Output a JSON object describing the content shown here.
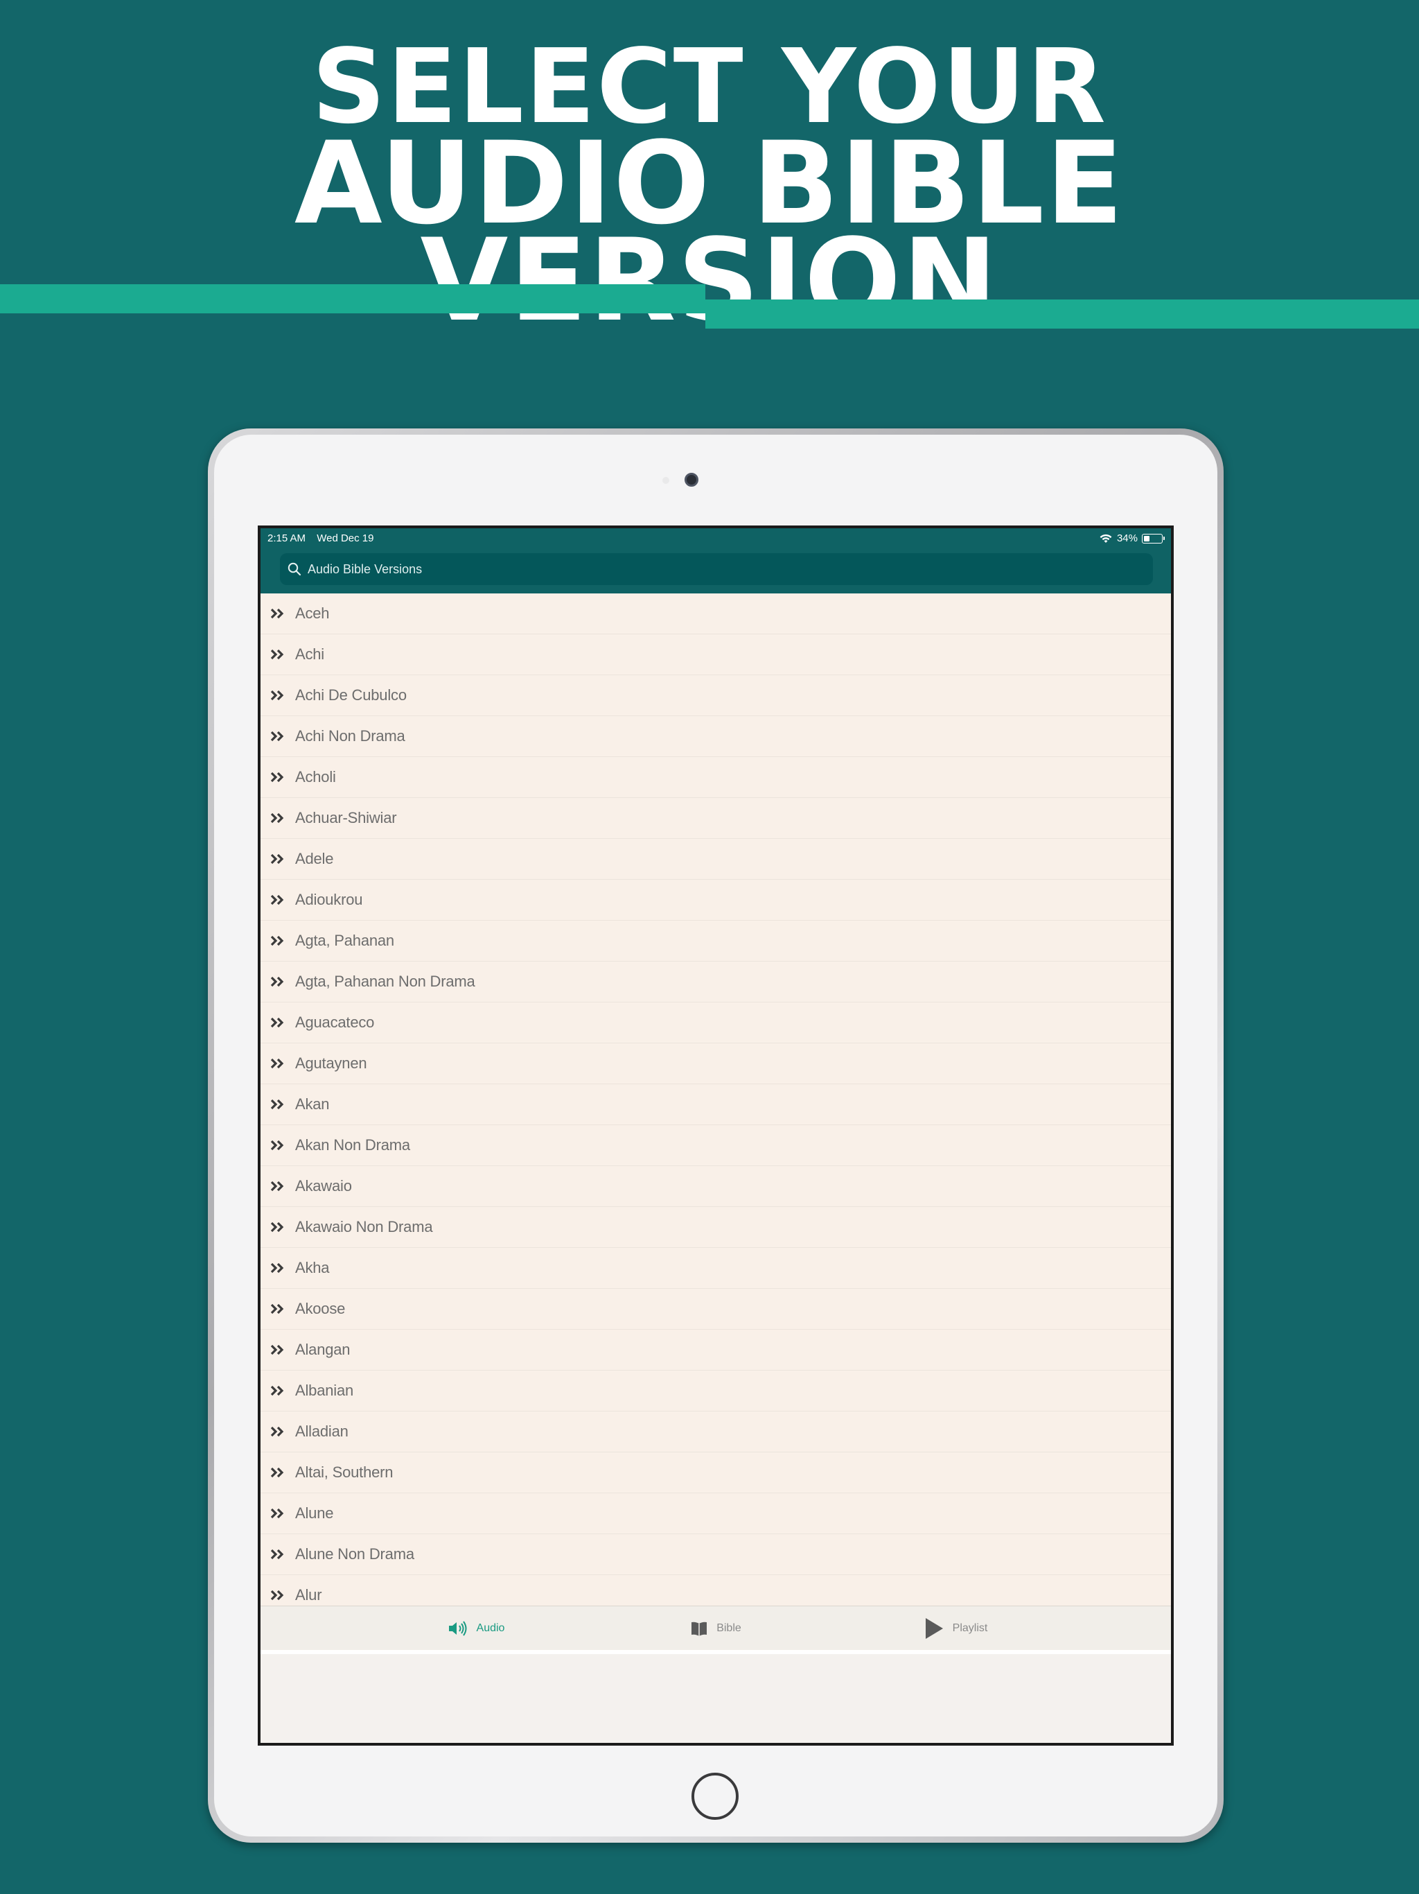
{
  "headline": {
    "line1": "Select Your",
    "line2": "Audio Bible Version"
  },
  "colors": {
    "background": "#136669",
    "stripe": "#1bab91",
    "header": "#0f6264",
    "accent_active": "#1a9a82"
  },
  "status_bar": {
    "time": "2:15 AM",
    "date": "Wed Dec 19",
    "battery": "34%",
    "wifi_icon": "wifi-icon",
    "battery_icon": "battery-icon"
  },
  "search": {
    "placeholder": "Audio Bible Versions",
    "icon": "search-icon"
  },
  "versions": [
    "Aceh",
    "Achi",
    "Achi De Cubulco",
    "Achi Non Drama",
    "Acholi",
    "Achuar-Shiwiar",
    "Adele",
    "Adioukrou",
    "Agta, Pahanan",
    "Agta, Pahanan Non Drama",
    "Aguacateco",
    "Agutaynen",
    "Akan",
    "Akan Non Drama",
    "Akawaio",
    "Akawaio Non Drama",
    "Akha",
    "Akoose",
    "Alangan",
    "Albanian",
    "Alladian",
    "Altai, Southern",
    "Alune",
    "Alune Non Drama",
    "Alur"
  ],
  "tabs": [
    {
      "label": "Audio",
      "icon": "speaker-icon",
      "active": true
    },
    {
      "label": "Bible",
      "icon": "book-icon",
      "active": false
    },
    {
      "label": "Playlist",
      "icon": "play-icon",
      "active": false
    }
  ]
}
